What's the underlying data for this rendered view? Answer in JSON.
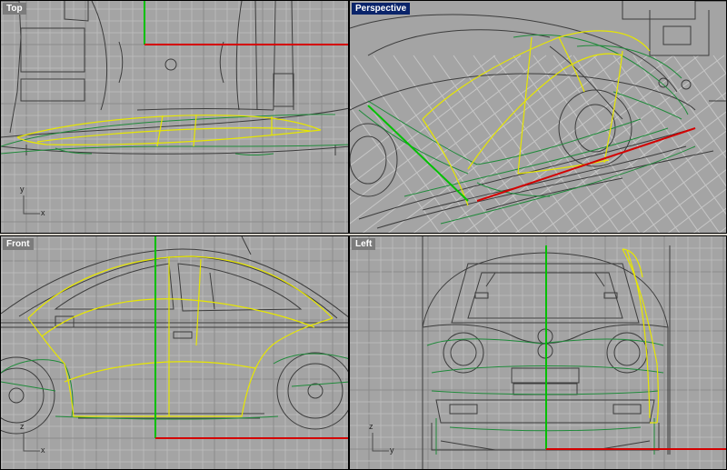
{
  "viewports": [
    {
      "id": "top",
      "label": "Top",
      "active": false,
      "axis_a": "y",
      "axis_b": "x"
    },
    {
      "id": "perspective",
      "label": "Perspective",
      "active": true
    },
    {
      "id": "front",
      "label": "Front",
      "active": false,
      "axis_a": "z",
      "axis_b": "x"
    },
    {
      "id": "left",
      "label": "Left",
      "active": false,
      "axis_a": "z",
      "axis_b": "y"
    }
  ],
  "colors": {
    "background": "#a4a4a4",
    "grid_minor": "#b9b9b9",
    "grid_major": "#8c8c8c",
    "reference_curves": "#3c3c3c",
    "surface_curves": "#1f8a3a",
    "selected_curves": "#e6e600",
    "x_axis": "#d40000",
    "y_axis": "#00c000",
    "active_label_bg": "#0a246a",
    "inactive_label_bg": "#7c7c7c"
  }
}
